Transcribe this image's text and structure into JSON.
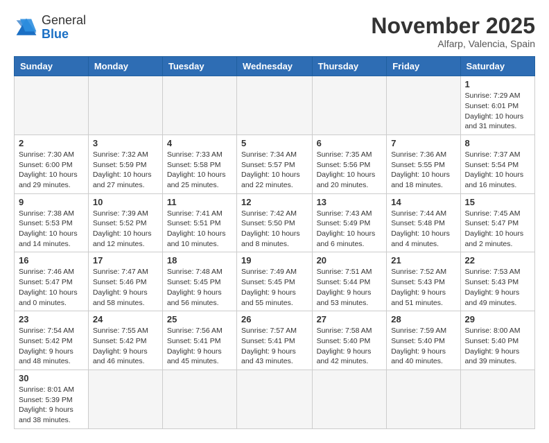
{
  "header": {
    "logo_general": "General",
    "logo_blue": "Blue",
    "month_title": "November 2025",
    "subtitle": "Alfarp, Valencia, Spain"
  },
  "weekdays": [
    "Sunday",
    "Monday",
    "Tuesday",
    "Wednesday",
    "Thursday",
    "Friday",
    "Saturday"
  ],
  "weeks": [
    [
      {
        "day": "",
        "info": ""
      },
      {
        "day": "",
        "info": ""
      },
      {
        "day": "",
        "info": ""
      },
      {
        "day": "",
        "info": ""
      },
      {
        "day": "",
        "info": ""
      },
      {
        "day": "",
        "info": ""
      },
      {
        "day": "1",
        "info": "Sunrise: 7:29 AM\nSunset: 6:01 PM\nDaylight: 10 hours\nand 31 minutes."
      }
    ],
    [
      {
        "day": "2",
        "info": "Sunrise: 7:30 AM\nSunset: 6:00 PM\nDaylight: 10 hours\nand 29 minutes."
      },
      {
        "day": "3",
        "info": "Sunrise: 7:32 AM\nSunset: 5:59 PM\nDaylight: 10 hours\nand 27 minutes."
      },
      {
        "day": "4",
        "info": "Sunrise: 7:33 AM\nSunset: 5:58 PM\nDaylight: 10 hours\nand 25 minutes."
      },
      {
        "day": "5",
        "info": "Sunrise: 7:34 AM\nSunset: 5:57 PM\nDaylight: 10 hours\nand 22 minutes."
      },
      {
        "day": "6",
        "info": "Sunrise: 7:35 AM\nSunset: 5:56 PM\nDaylight: 10 hours\nand 20 minutes."
      },
      {
        "day": "7",
        "info": "Sunrise: 7:36 AM\nSunset: 5:55 PM\nDaylight: 10 hours\nand 18 minutes."
      },
      {
        "day": "8",
        "info": "Sunrise: 7:37 AM\nSunset: 5:54 PM\nDaylight: 10 hours\nand 16 minutes."
      }
    ],
    [
      {
        "day": "9",
        "info": "Sunrise: 7:38 AM\nSunset: 5:53 PM\nDaylight: 10 hours\nand 14 minutes."
      },
      {
        "day": "10",
        "info": "Sunrise: 7:39 AM\nSunset: 5:52 PM\nDaylight: 10 hours\nand 12 minutes."
      },
      {
        "day": "11",
        "info": "Sunrise: 7:41 AM\nSunset: 5:51 PM\nDaylight: 10 hours\nand 10 minutes."
      },
      {
        "day": "12",
        "info": "Sunrise: 7:42 AM\nSunset: 5:50 PM\nDaylight: 10 hours\nand 8 minutes."
      },
      {
        "day": "13",
        "info": "Sunrise: 7:43 AM\nSunset: 5:49 PM\nDaylight: 10 hours\nand 6 minutes."
      },
      {
        "day": "14",
        "info": "Sunrise: 7:44 AM\nSunset: 5:48 PM\nDaylight: 10 hours\nand 4 minutes."
      },
      {
        "day": "15",
        "info": "Sunrise: 7:45 AM\nSunset: 5:47 PM\nDaylight: 10 hours\nand 2 minutes."
      }
    ],
    [
      {
        "day": "16",
        "info": "Sunrise: 7:46 AM\nSunset: 5:47 PM\nDaylight: 10 hours\nand 0 minutes."
      },
      {
        "day": "17",
        "info": "Sunrise: 7:47 AM\nSunset: 5:46 PM\nDaylight: 9 hours\nand 58 minutes."
      },
      {
        "day": "18",
        "info": "Sunrise: 7:48 AM\nSunset: 5:45 PM\nDaylight: 9 hours\nand 56 minutes."
      },
      {
        "day": "19",
        "info": "Sunrise: 7:49 AM\nSunset: 5:45 PM\nDaylight: 9 hours\nand 55 minutes."
      },
      {
        "day": "20",
        "info": "Sunrise: 7:51 AM\nSunset: 5:44 PM\nDaylight: 9 hours\nand 53 minutes."
      },
      {
        "day": "21",
        "info": "Sunrise: 7:52 AM\nSunset: 5:43 PM\nDaylight: 9 hours\nand 51 minutes."
      },
      {
        "day": "22",
        "info": "Sunrise: 7:53 AM\nSunset: 5:43 PM\nDaylight: 9 hours\nand 49 minutes."
      }
    ],
    [
      {
        "day": "23",
        "info": "Sunrise: 7:54 AM\nSunset: 5:42 PM\nDaylight: 9 hours\nand 48 minutes."
      },
      {
        "day": "24",
        "info": "Sunrise: 7:55 AM\nSunset: 5:42 PM\nDaylight: 9 hours\nand 46 minutes."
      },
      {
        "day": "25",
        "info": "Sunrise: 7:56 AM\nSunset: 5:41 PM\nDaylight: 9 hours\nand 45 minutes."
      },
      {
        "day": "26",
        "info": "Sunrise: 7:57 AM\nSunset: 5:41 PM\nDaylight: 9 hours\nand 43 minutes."
      },
      {
        "day": "27",
        "info": "Sunrise: 7:58 AM\nSunset: 5:40 PM\nDaylight: 9 hours\nand 42 minutes."
      },
      {
        "day": "28",
        "info": "Sunrise: 7:59 AM\nSunset: 5:40 PM\nDaylight: 9 hours\nand 40 minutes."
      },
      {
        "day": "29",
        "info": "Sunrise: 8:00 AM\nSunset: 5:40 PM\nDaylight: 9 hours\nand 39 minutes."
      }
    ],
    [
      {
        "day": "30",
        "info": "Sunrise: 8:01 AM\nSunset: 5:39 PM\nDaylight: 9 hours\nand 38 minutes."
      },
      {
        "day": "",
        "info": ""
      },
      {
        "day": "",
        "info": ""
      },
      {
        "day": "",
        "info": ""
      },
      {
        "day": "",
        "info": ""
      },
      {
        "day": "",
        "info": ""
      },
      {
        "day": "",
        "info": ""
      }
    ]
  ]
}
